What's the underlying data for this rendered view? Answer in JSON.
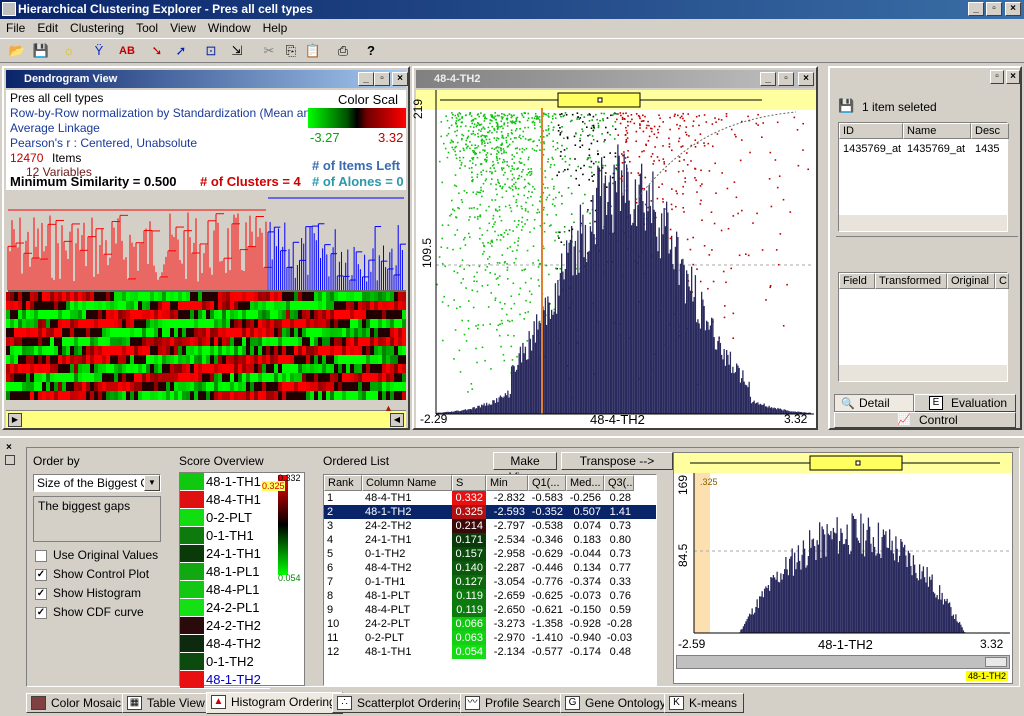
{
  "app": {
    "title": "Hierarchical Clustering Explorer - Pres all cell types"
  },
  "menu": [
    "File",
    "Edit",
    "Clustering",
    "Tool",
    "View",
    "Window",
    "Help"
  ],
  "dendro": {
    "title": "Dendrogram View",
    "line1": "Pres all cell types",
    "line2": "Row-by-Row normalization by Standardization (Mean and St",
    "line3": "Average Linkage",
    "line4": "Pearson's r : Centered, Unabsolute",
    "items_count": "12470",
    "items_label": "Items",
    "variables": "12 Variables",
    "min_sim": "Minimum Similarity = 0.500",
    "clusters": "# of Clusters = 4",
    "items_left": "# of Items Left",
    "alones": "# of Alones = 0",
    "color_scale_label": "Color Scal",
    "scale_min": "-3.27",
    "scale_max": "3.32"
  },
  "histo_top": {
    "title": "48-4-TH2",
    "ytop": "219",
    "ymid": "109.5",
    "xmin": "-2.29",
    "xmax": "3.32",
    "xlabel": "48-4-TH2"
  },
  "detail": {
    "selected": "1 item seleted",
    "cols": [
      "ID",
      "Name",
      "Desc"
    ],
    "row": [
      "1435769_at",
      "1435769_at",
      "1435"
    ],
    "cols2": [
      "Field",
      "Transformed",
      "Original",
      "C"
    ],
    "tab_detail": "Detail",
    "tab_eval": "Evaluation",
    "tab_control": "Control"
  },
  "order": {
    "label": "Order by",
    "select": "Size of the Biggest Ga",
    "desc": "The biggest gaps",
    "opts": [
      {
        "label": "Use Original Values",
        "checked": false
      },
      {
        "label": "Show Control Plot",
        "checked": true
      },
      {
        "label": "Show Histogram",
        "checked": true
      },
      {
        "label": "Show CDF curve",
        "checked": true
      }
    ]
  },
  "score": {
    "label": "Score Overview",
    "items": [
      "48-1-TH1",
      "48-4-TH1",
      "0-2-PLT",
      "0-1-TH1",
      "24-1-TH1",
      "48-1-PL1",
      "48-4-PL1",
      "24-2-PL1",
      "24-2-TH2",
      "48-4-TH2",
      "0-1-TH2",
      "48-1-TH2"
    ],
    "colors": [
      "#11c811",
      "#e01010",
      "#11dd11",
      "#0e7a0e",
      "#0a3a0a",
      "#11a811",
      "#13c813",
      "#15e015",
      "#2a0a0a",
      "#0e2a0e",
      "#0d4a0d",
      "#e81010"
    ],
    "scale_top": "0.332",
    "scale_mark": "0.325",
    "scale_bottom": "0.054"
  },
  "ordered": {
    "label": "Ordered List",
    "make_views": "Make Views",
    "transpose": "Transpose -->",
    "headers": [
      "Rank",
      "Column Name",
      "S",
      "Min",
      "Q1(...",
      "Med...",
      "Q3(..."
    ],
    "rows": [
      [
        "1",
        "48-4-TH1",
        "0.332",
        "-2.832",
        "-0.583",
        "-0.256",
        "0.28"
      ],
      [
        "2",
        "48-1-TH2",
        "0.325",
        "-2.593",
        "-0.352",
        "0.507",
        "1.41"
      ],
      [
        "3",
        "24-2-TH2",
        "0.214",
        "-2.797",
        "-0.538",
        "0.074",
        "0.73"
      ],
      [
        "4",
        "24-1-TH1",
        "0.171",
        "-2.534",
        "-0.346",
        "0.183",
        "0.80"
      ],
      [
        "5",
        "0-1-TH2",
        "0.157",
        "-2.958",
        "-0.629",
        "-0.044",
        "0.73"
      ],
      [
        "6",
        "48-4-TH2",
        "0.140",
        "-2.287",
        "-0.446",
        "0.134",
        "0.77"
      ],
      [
        "7",
        "0-1-TH1",
        "0.127",
        "-3.054",
        "-0.776",
        "-0.374",
        "0.33"
      ],
      [
        "8",
        "48-1-PLT",
        "0.119",
        "-2.659",
        "-0.625",
        "-0.073",
        "0.76"
      ],
      [
        "9",
        "48-4-PLT",
        "0.119",
        "-2.650",
        "-0.621",
        "-0.150",
        "0.59"
      ],
      [
        "10",
        "24-2-PLT",
        "0.066",
        "-3.273",
        "-1.358",
        "-0.928",
        "-0.28"
      ],
      [
        "11",
        "0-2-PLT",
        "0.063",
        "-2.970",
        "-1.410",
        "-0.940",
        "-0.03"
      ],
      [
        "12",
        "48-1-TH1",
        "0.054",
        "-2.134",
        "-0.577",
        "-0.174",
        "0.48"
      ]
    ],
    "scorecolors": [
      "#e81010",
      "#b01010",
      "#3a0a0a",
      "#0a3a0a",
      "#0a4a0a",
      "#0b5a0b",
      "#0c6a0c",
      "#0d7a0d",
      "#0d7a0d",
      "#11c811",
      "#12d012",
      "#14dd14"
    ]
  },
  "histo_bottom": {
    "ytop": "169",
    "ymid": "84.5",
    "xmin": "-2.59",
    "xmax": "3.32",
    "xlabel": "48-1-TH2",
    "mark": ".325",
    "badge": "48-1-TH2"
  },
  "tabs": [
    "Color Mosaic",
    "Table View",
    "Histogram Ordering",
    "Scatterplot Ordering",
    "Profile Search",
    "Gene Ontology",
    "K-means"
  ]
}
